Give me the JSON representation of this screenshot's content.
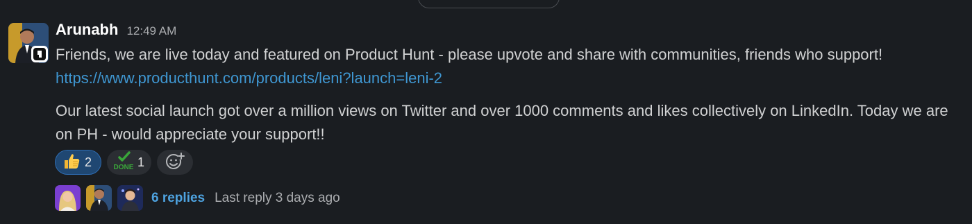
{
  "message": {
    "author": "Arunabh",
    "timestamp": "12:49 AM",
    "line1": "Friends, we are live today and featured on Product Hunt - please upvote and share with communities, friends who support!",
    "link": "https://www.producthunt.com/products/leni?launch=leni-2",
    "paragraph2": "Our latest social launch got over a million views on Twitter and over 1000 comments and likes collectively on LinkedIn. Today we are on PH - would appreciate your support!!"
  },
  "reactions": [
    {
      "icon": "thumbs-up-icon",
      "count": "2",
      "active": true
    },
    {
      "icon": "done-icon",
      "label": "DONE",
      "count": "1",
      "active": false
    }
  ],
  "thread": {
    "replies_label": "6 replies",
    "last_reply": "Last reply 3 days ago"
  },
  "colors": {
    "background": "#1a1d21",
    "link": "#3f97d2",
    "reaction_active_bg": "#1f4772",
    "done_green": "#3aa63a"
  }
}
